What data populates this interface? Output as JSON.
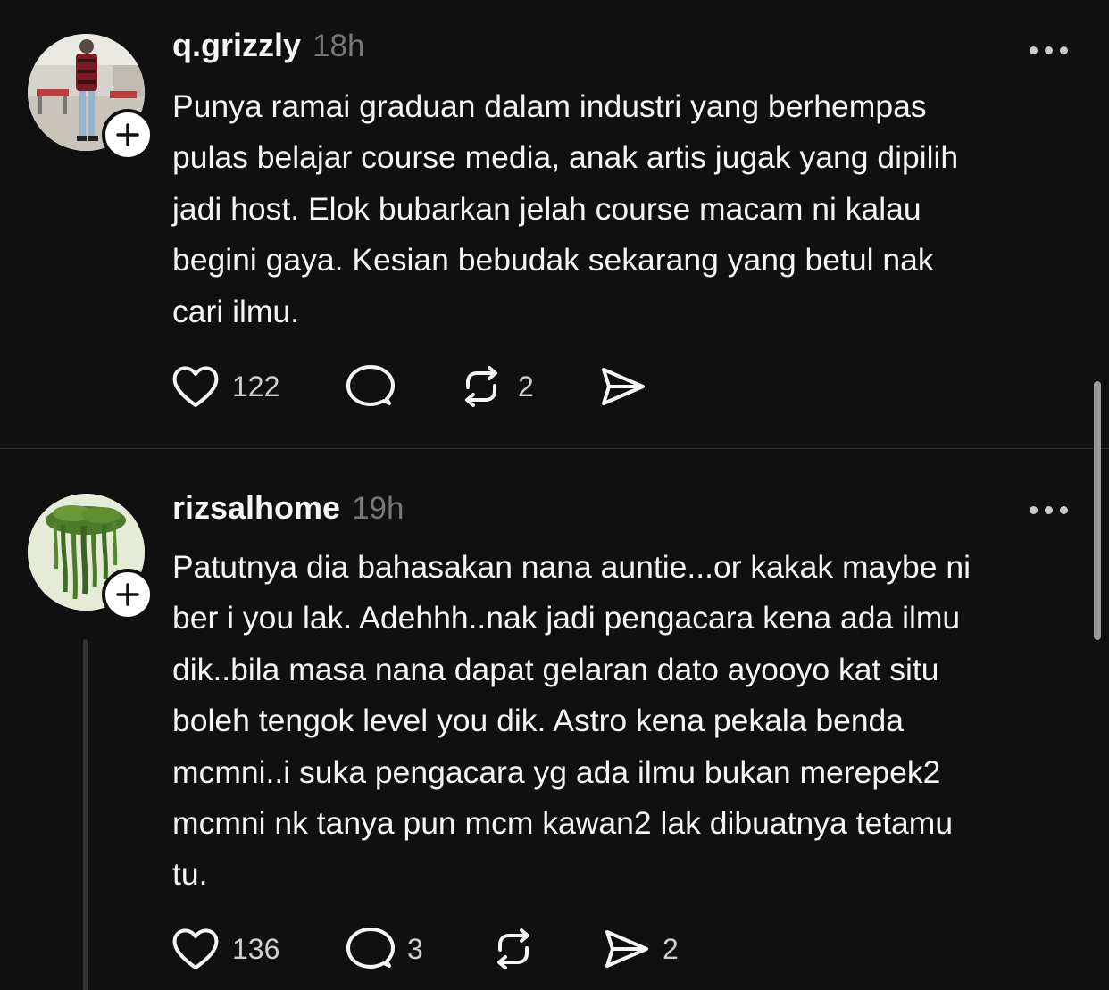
{
  "posts": [
    {
      "username": "q.grizzly",
      "time": "18h",
      "text": "Punya ramai graduan dalam industri yang berhempas\npulas belajar course media, anak artis jugak yang dipilih\njadi host. Elok bubarkan jelah course macam ni kalau\nbegini gaya. Kesian bebudak sekarang yang betul nak\ncari ilmu.",
      "likes": "122",
      "replies": "",
      "reposts": "2",
      "shares": ""
    },
    {
      "username": "rizsalhome",
      "time": "19h",
      "text": "Patutnya dia bahasakan nana auntie...or kakak maybe ni\nber i you lak. Adehhh..nak jadi pengacara kena ada ilmu\ndik..bila masa nana dapat gelaran dato ayooyo kat situ\nboleh tengok level you dik. Astro kena pekala benda\nmcmni..i suka pengacara yg ada ilmu bukan merepek2\nmcmni nk tanya pun mcm kawan2 lak dibuatnya tetamu\ntu.",
      "likes": "136",
      "replies": "3",
      "reposts": "",
      "shares": "2"
    }
  ],
  "icons": {
    "like": "heart-icon",
    "reply": "comment-icon",
    "repost": "repost-icon",
    "share": "send-icon",
    "more": "more-icon",
    "follow": "plus-icon"
  },
  "colors": {
    "background": "#101010",
    "text": "#f3f5f7",
    "muted": "#777777",
    "divider": "#2d2d2d"
  }
}
